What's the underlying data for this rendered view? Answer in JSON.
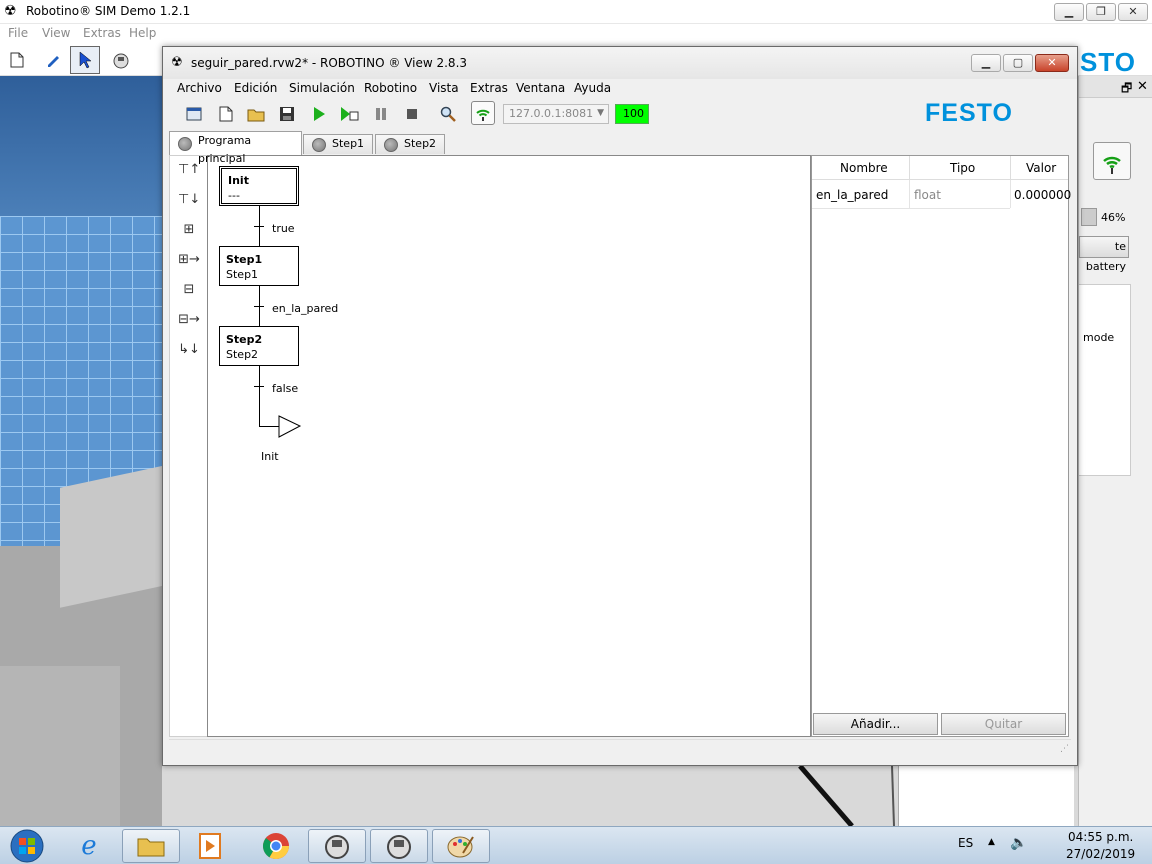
{
  "sim": {
    "title": "Robotino® SIM Demo 1.2.1",
    "menu": [
      "File",
      "View",
      "Extras",
      "Help"
    ],
    "logo_text": "STO",
    "battery_pct": "46%",
    "battery_button": "te battery",
    "mode_label": "mode"
  },
  "rv": {
    "title": "seguir_pared.rvw2* - ROBOTINO ® View 2.8.3",
    "menu": [
      "Archivo",
      "Edición",
      "Simulación",
      "Robotino",
      "Vista",
      "Extras",
      "Ventana",
      "Ayuda"
    ],
    "address": "127.0.0.1:8081",
    "status_value": "100",
    "brand": "FESTO",
    "tabs": [
      "Programa principal",
      "Step1",
      "Step2"
    ],
    "steps": [
      {
        "name": "Init",
        "sub": "---"
      },
      {
        "name": "Step1",
        "sub": "Step1"
      },
      {
        "name": "Step2",
        "sub": "Step2"
      }
    ],
    "transitions": [
      "true",
      "en_la_pared",
      "false"
    ],
    "jump_target": "Init",
    "vars_headers": [
      "Nombre",
      "Tipo",
      "Valor"
    ],
    "vars_rows": [
      {
        "name": "en_la_pared",
        "type": "float",
        "value": "0.000000"
      }
    ],
    "add_button": "Añadir...",
    "remove_button": "Quitar"
  },
  "taskbar": {
    "lang": "ES",
    "time": "04:55 p.m.",
    "date": "27/02/2019"
  },
  "colors": {
    "accent_green": "#00ff00",
    "festo_blue": "#0091dc"
  }
}
